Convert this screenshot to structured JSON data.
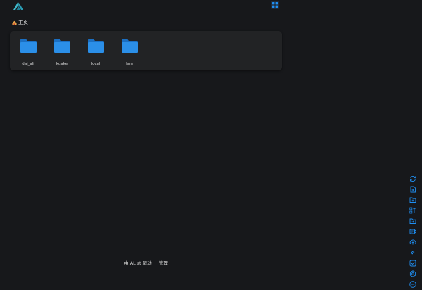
{
  "breadcrumb": {
    "home_label": "主页"
  },
  "folders": [
    {
      "name": "dai_ali"
    },
    {
      "name": "kuake"
    },
    {
      "name": "local"
    },
    {
      "name": "lsm"
    }
  ],
  "footer": {
    "powered_by": "由 AList 驱动",
    "separator": "|",
    "manage": "管理"
  },
  "colors": {
    "accent": "#1f8ef1",
    "folder": "#2b8fe8",
    "logo": "#3fb6c8"
  },
  "toolbar_icons": [
    "refresh-icon",
    "new-file-icon",
    "new-folder-icon",
    "sort-icon",
    "folder-move-icon",
    "cast-icon",
    "upload-icon",
    "wifi-icon",
    "checkbox-icon",
    "settings-icon",
    "more-icon"
  ]
}
